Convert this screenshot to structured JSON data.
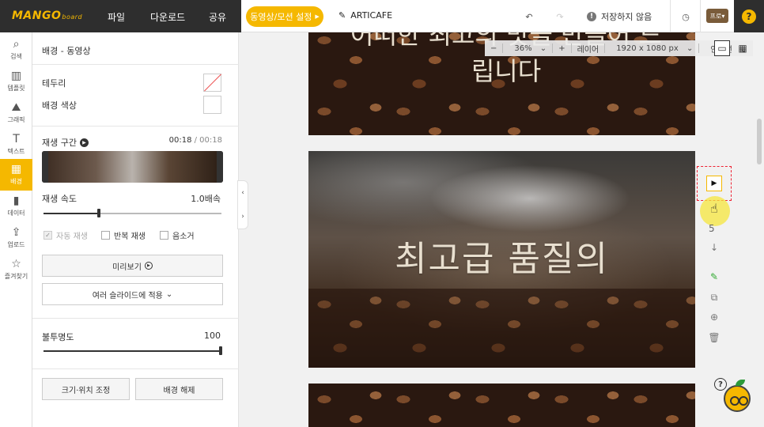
{
  "topbar": {
    "logo": "MANGO",
    "logo_sub": "board",
    "menu": [
      "파일",
      "다운로드",
      "공유"
    ],
    "motion_button": "동영상/모션 설정",
    "design_title": "ARTICAFE",
    "save_status": "저장하지 않음",
    "plan_badge": "프로",
    "help": "?"
  },
  "rail": [
    {
      "label": "검색",
      "icon": "search-icon",
      "glyph": "⌕"
    },
    {
      "label": "템플릿",
      "icon": "template-icon",
      "glyph": "▥"
    },
    {
      "label": "그래픽",
      "icon": "graphic-icon",
      "glyph": "⛰"
    },
    {
      "label": "텍스트",
      "icon": "text-icon",
      "glyph": "T"
    },
    {
      "label": "배경",
      "icon": "background-icon",
      "glyph": "▦"
    },
    {
      "label": "데이터",
      "icon": "chart-icon",
      "glyph": "▮"
    },
    {
      "label": "업로드",
      "icon": "upload-icon",
      "glyph": "⇪"
    },
    {
      "label": "즐겨찾기",
      "icon": "star-icon",
      "glyph": "☆"
    }
  ],
  "panel": {
    "title": "배경 - 동영상",
    "border_label": "테두리",
    "bgcolor_label": "배경 색상",
    "play_range_label": "재생 구간",
    "current_time": "00:18",
    "total_time": "/ 00:18",
    "speed_label": "재생 속도",
    "speed_value": "1.0배속",
    "speed_fraction": 0.31,
    "autoplay": "자동 재생",
    "loop": "반복 재생",
    "mute": "음소거",
    "preview": "미리보기",
    "apply_multi": "여러 슬라이드에 적용",
    "opacity_label": "불투명도",
    "opacity_value": "100",
    "resize_btn": "크기·위치 조정",
    "release_btn": "배경 해제"
  },
  "canvas": {
    "zoom_minus": "−",
    "zoom": "36%",
    "zoom_plus": "+",
    "layer": "레이어",
    "size": "1920 x 1080 px",
    "guide": "안내선",
    "slide1_text": "어떠한 최고의 맛을 만들어 드립니다",
    "slide2_heading": "최고급 품질의",
    "slide_number": "5"
  },
  "colors": {
    "accent": "#f5b800",
    "dark": "#2e2e2e"
  }
}
